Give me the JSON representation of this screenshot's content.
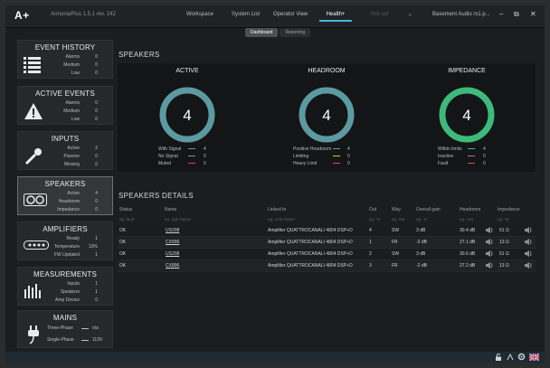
{
  "app": {
    "logo": "A+",
    "title": "ArmoniaPlus 1.5.1 rev. 242",
    "nav_tabs": [
      {
        "label": "Workspace"
      },
      {
        "label": "System List"
      },
      {
        "label": "Operator View"
      },
      {
        "label": "Health+"
      },
      {
        "label": "Not set"
      },
      {
        "label": "Basement Audio rx1.p..."
      }
    ]
  },
  "subtabs": [
    {
      "label": "Dashboard"
    },
    {
      "label": "Reporting"
    }
  ],
  "sidebar": {
    "event_history": {
      "title": "EVENT HISTORY",
      "rows": [
        {
          "label": "Alarms",
          "value": "0"
        },
        {
          "label": "Medium",
          "value": "0"
        },
        {
          "label": "Low",
          "value": "0"
        }
      ]
    },
    "active_events": {
      "title": "ACTIVE EVENTS",
      "rows": [
        {
          "label": "Alarms",
          "value": "0"
        },
        {
          "label": "Medium",
          "value": "0"
        },
        {
          "label": "Low",
          "value": "0"
        }
      ]
    },
    "inputs": {
      "title": "INPUTS",
      "rows": [
        {
          "label": "Active",
          "value": "2"
        },
        {
          "label": "Passive",
          "value": "0"
        },
        {
          "label": "Missing",
          "value": "0"
        }
      ]
    },
    "speakers": {
      "title": "SPEAKERS",
      "rows": [
        {
          "label": "Active",
          "value": "4"
        },
        {
          "label": "Headroom",
          "value": "0"
        },
        {
          "label": "Impedance",
          "value": "0"
        }
      ]
    },
    "amplifiers": {
      "title": "AMPLIFIERS",
      "rows": [
        {
          "label": "Ready",
          "value": "1"
        },
        {
          "label": "Temperature",
          "value": "10%"
        },
        {
          "label": "FW Updated",
          "value": "1"
        }
      ]
    },
    "measurements": {
      "title": "MEASUREMENTS",
      "rows": [
        {
          "label": "Inputs",
          "value": "1"
        },
        {
          "label": "Speakers",
          "value": "1"
        },
        {
          "label": "Amp Device",
          "value": "0"
        }
      ]
    },
    "mains": {
      "title": "MAINS",
      "rows": [
        {
          "label": "Three-Phase",
          "value": "n/a"
        },
        {
          "label": "Single-Phase",
          "value": "119V"
        }
      ]
    }
  },
  "speakers_section": {
    "title": "SPEAKERS",
    "gauges": [
      {
        "title": "ACTIVE",
        "value": "4",
        "color": "#5b9aa0",
        "legend": [
          {
            "label": "With Signal",
            "color": "#5b9aa0",
            "value": "4"
          },
          {
            "label": "No Signal",
            "color": "#8a8f93",
            "value": "0"
          },
          {
            "label": "Muted",
            "color": "#d84a4a",
            "value": "0"
          }
        ]
      },
      {
        "title": "HEADROOM",
        "value": "4",
        "color": "#5b9aa0",
        "legend": [
          {
            "label": "Positive Headroom",
            "color": "#5b9aa0",
            "value": "4"
          },
          {
            "label": "Limiting",
            "color": "#e0c341",
            "value": "0"
          },
          {
            "label": "Heavy Limit",
            "color": "#d84a4a",
            "value": "0"
          }
        ]
      },
      {
        "title": "IMPEDANCE",
        "value": "4",
        "color": "#3dba7a",
        "legend": [
          {
            "label": "Within limits",
            "color": "#3dba7a",
            "value": "4"
          },
          {
            "label": "Inactive",
            "color": "#8a8f93",
            "value": "0"
          },
          {
            "label": "Fault",
            "color": "#d84a4a",
            "value": "0"
          }
        ]
      }
    ]
  },
  "details": {
    "title": "SPEAKERS DETAILS",
    "columns": [
      "Status",
      "Name",
      "Linked to",
      "Out",
      "Way",
      "Overall gain",
      "Headroom",
      "Impedance"
    ],
    "filters": [
      "eg. fault",
      "eg. Spk Name",
      "eg. Amp Name",
      "eg. >4",
      "eg. SW",
      "eg. -6",
      "eg. >20",
      "eg. <8"
    ],
    "rows": [
      {
        "status": "OK",
        "name": "US208",
        "linked": "Amplifier QUATTROCANALI 4804 DSP+D",
        "out": "4",
        "way": "SW",
        "gain": "3 dB",
        "headroom": "30.4 dB",
        "impedance": "51 Ω"
      },
      {
        "status": "OK",
        "name": "CX896",
        "linked": "Amplifier QUATTROCANALI 4804 DSP+D",
        "out": "1",
        "way": "FR",
        "gain": "-2 dB",
        "headroom": "27.1 dB",
        "impedance": "13 Ω"
      },
      {
        "status": "OK",
        "name": "US208",
        "linked": "Amplifier QUATTROCANALI 4804 DSP+D",
        "out": "2",
        "way": "SW",
        "gain": "3 dB",
        "headroom": "30.6 dB",
        "impedance": "51 Ω"
      },
      {
        "status": "OK",
        "name": "CX896",
        "linked": "Amplifier QUATTROCANALI 4804 DSP+D",
        "out": "3",
        "way": "FR",
        "gain": "-2 dB",
        "headroom": "27.2 dB",
        "impedance": "13 Ω"
      }
    ]
  }
}
